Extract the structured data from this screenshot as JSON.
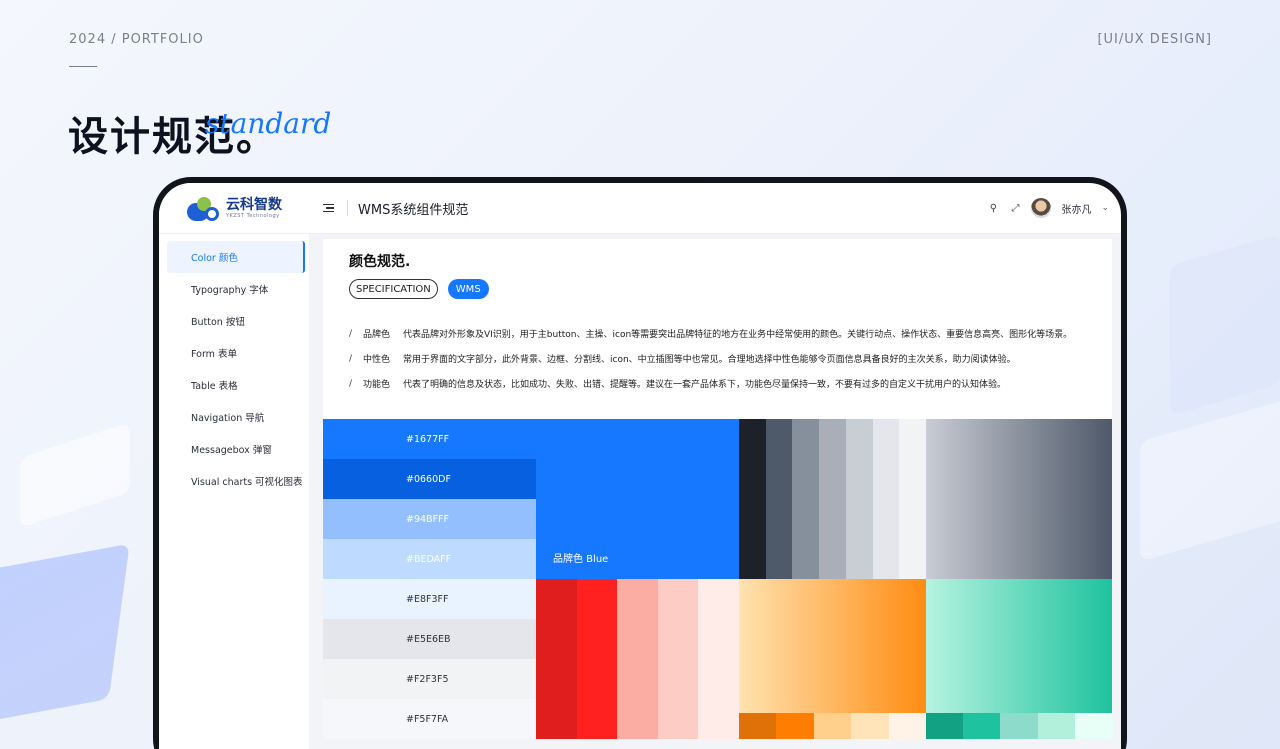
{
  "page": {
    "year_portfolio": "2024 / PORTFOLIO",
    "category": "[UI/UX DESIGN]",
    "title": "设计规范。",
    "script_word": "standard"
  },
  "app": {
    "logo_name": "云科智数",
    "logo_sub": "YKZST Technology",
    "header_title": "WMS系统组件规范",
    "user_name": "张亦凡"
  },
  "sidebar": {
    "items": [
      {
        "label": "Color 颜色",
        "active": true
      },
      {
        "label": "Typography 字体",
        "active": false
      },
      {
        "label": "Button 按钮",
        "active": false
      },
      {
        "label": "Form 表单",
        "active": false
      },
      {
        "label": "Table 表格",
        "active": false
      },
      {
        "label": "Navigation 导航",
        "active": false
      },
      {
        "label": "Messagebox 弹窗",
        "active": false
      },
      {
        "label": "Visual charts 可视化图表",
        "active": false
      }
    ]
  },
  "content": {
    "card_title": "颜色规范.",
    "tag_spec": "SPECIFICATION",
    "tag_wms": "WMS",
    "descriptions": [
      {
        "label": "品牌色",
        "text": "代表品牌对外形象及VI识别，用于主button、主操、icon等需要突出品牌特征的地方在业务中经常使用的颜色。关键行动点、操作状态、重要信息高亮、图形化等场景。"
      },
      {
        "label": "中性色",
        "text": "常用于界面的文字部分，此外背景、边框、分割线、icon、中立插图等中也常见。合理地选择中性色能够令页面信息具备良好的主次关系，助力阅读体验。"
      },
      {
        "label": "功能色",
        "text": "代表了明确的信息及状态，比如成功、失败、出错、提醒等。建议在一套产品体系下，功能色尽量保持一致，不要有过多的自定义干扰用户的认知体验。"
      }
    ]
  },
  "palette": {
    "shades": [
      {
        "hex": "#1677FF",
        "bg": "#1677ff",
        "fg": "#ffffff"
      },
      {
        "hex": "#0660DF",
        "bg": "#0660df",
        "fg": "#ffffff"
      },
      {
        "hex": "#94BFFF",
        "bg": "#94bfff",
        "fg": "#ffffff"
      },
      {
        "hex": "#BEDAFF",
        "bg": "#bedaff",
        "fg": "#ffffff"
      },
      {
        "hex": "#E8F3FF",
        "bg": "#e8f3ff",
        "fg": "#333333"
      },
      {
        "hex": "#E5E6EB",
        "bg": "#e5e6eb",
        "fg": "#333333"
      },
      {
        "hex": "#F2F3F5",
        "bg": "#f2f3f5",
        "fg": "#333333"
      },
      {
        "hex": "#F5F7FA",
        "bg": "#f5f7fa",
        "fg": "#333333"
      }
    ],
    "brand_label": "品牌色 Blue",
    "brand_color": "#1677ff",
    "neutral_stripes": [
      "#1d2129",
      "#4e5969",
      "#86909c",
      "#a9aeb8",
      "#c9cdd4",
      "#e5e6eb",
      "#f2f3f5"
    ],
    "red_stripes": [
      "#e01e1e",
      "#ff2020",
      "#fbaca3",
      "#fdcdc5",
      "#ffece8"
    ],
    "orange_stripes": [
      "#e07008",
      "#ff7d00",
      "#ffcf8b",
      "#ffe4ba",
      "#fff3e8"
    ],
    "green_stripes": [
      "#12a182",
      "#1ec29e",
      "#8ddbca",
      "#b3f0dc",
      "#e8fff8"
    ]
  }
}
